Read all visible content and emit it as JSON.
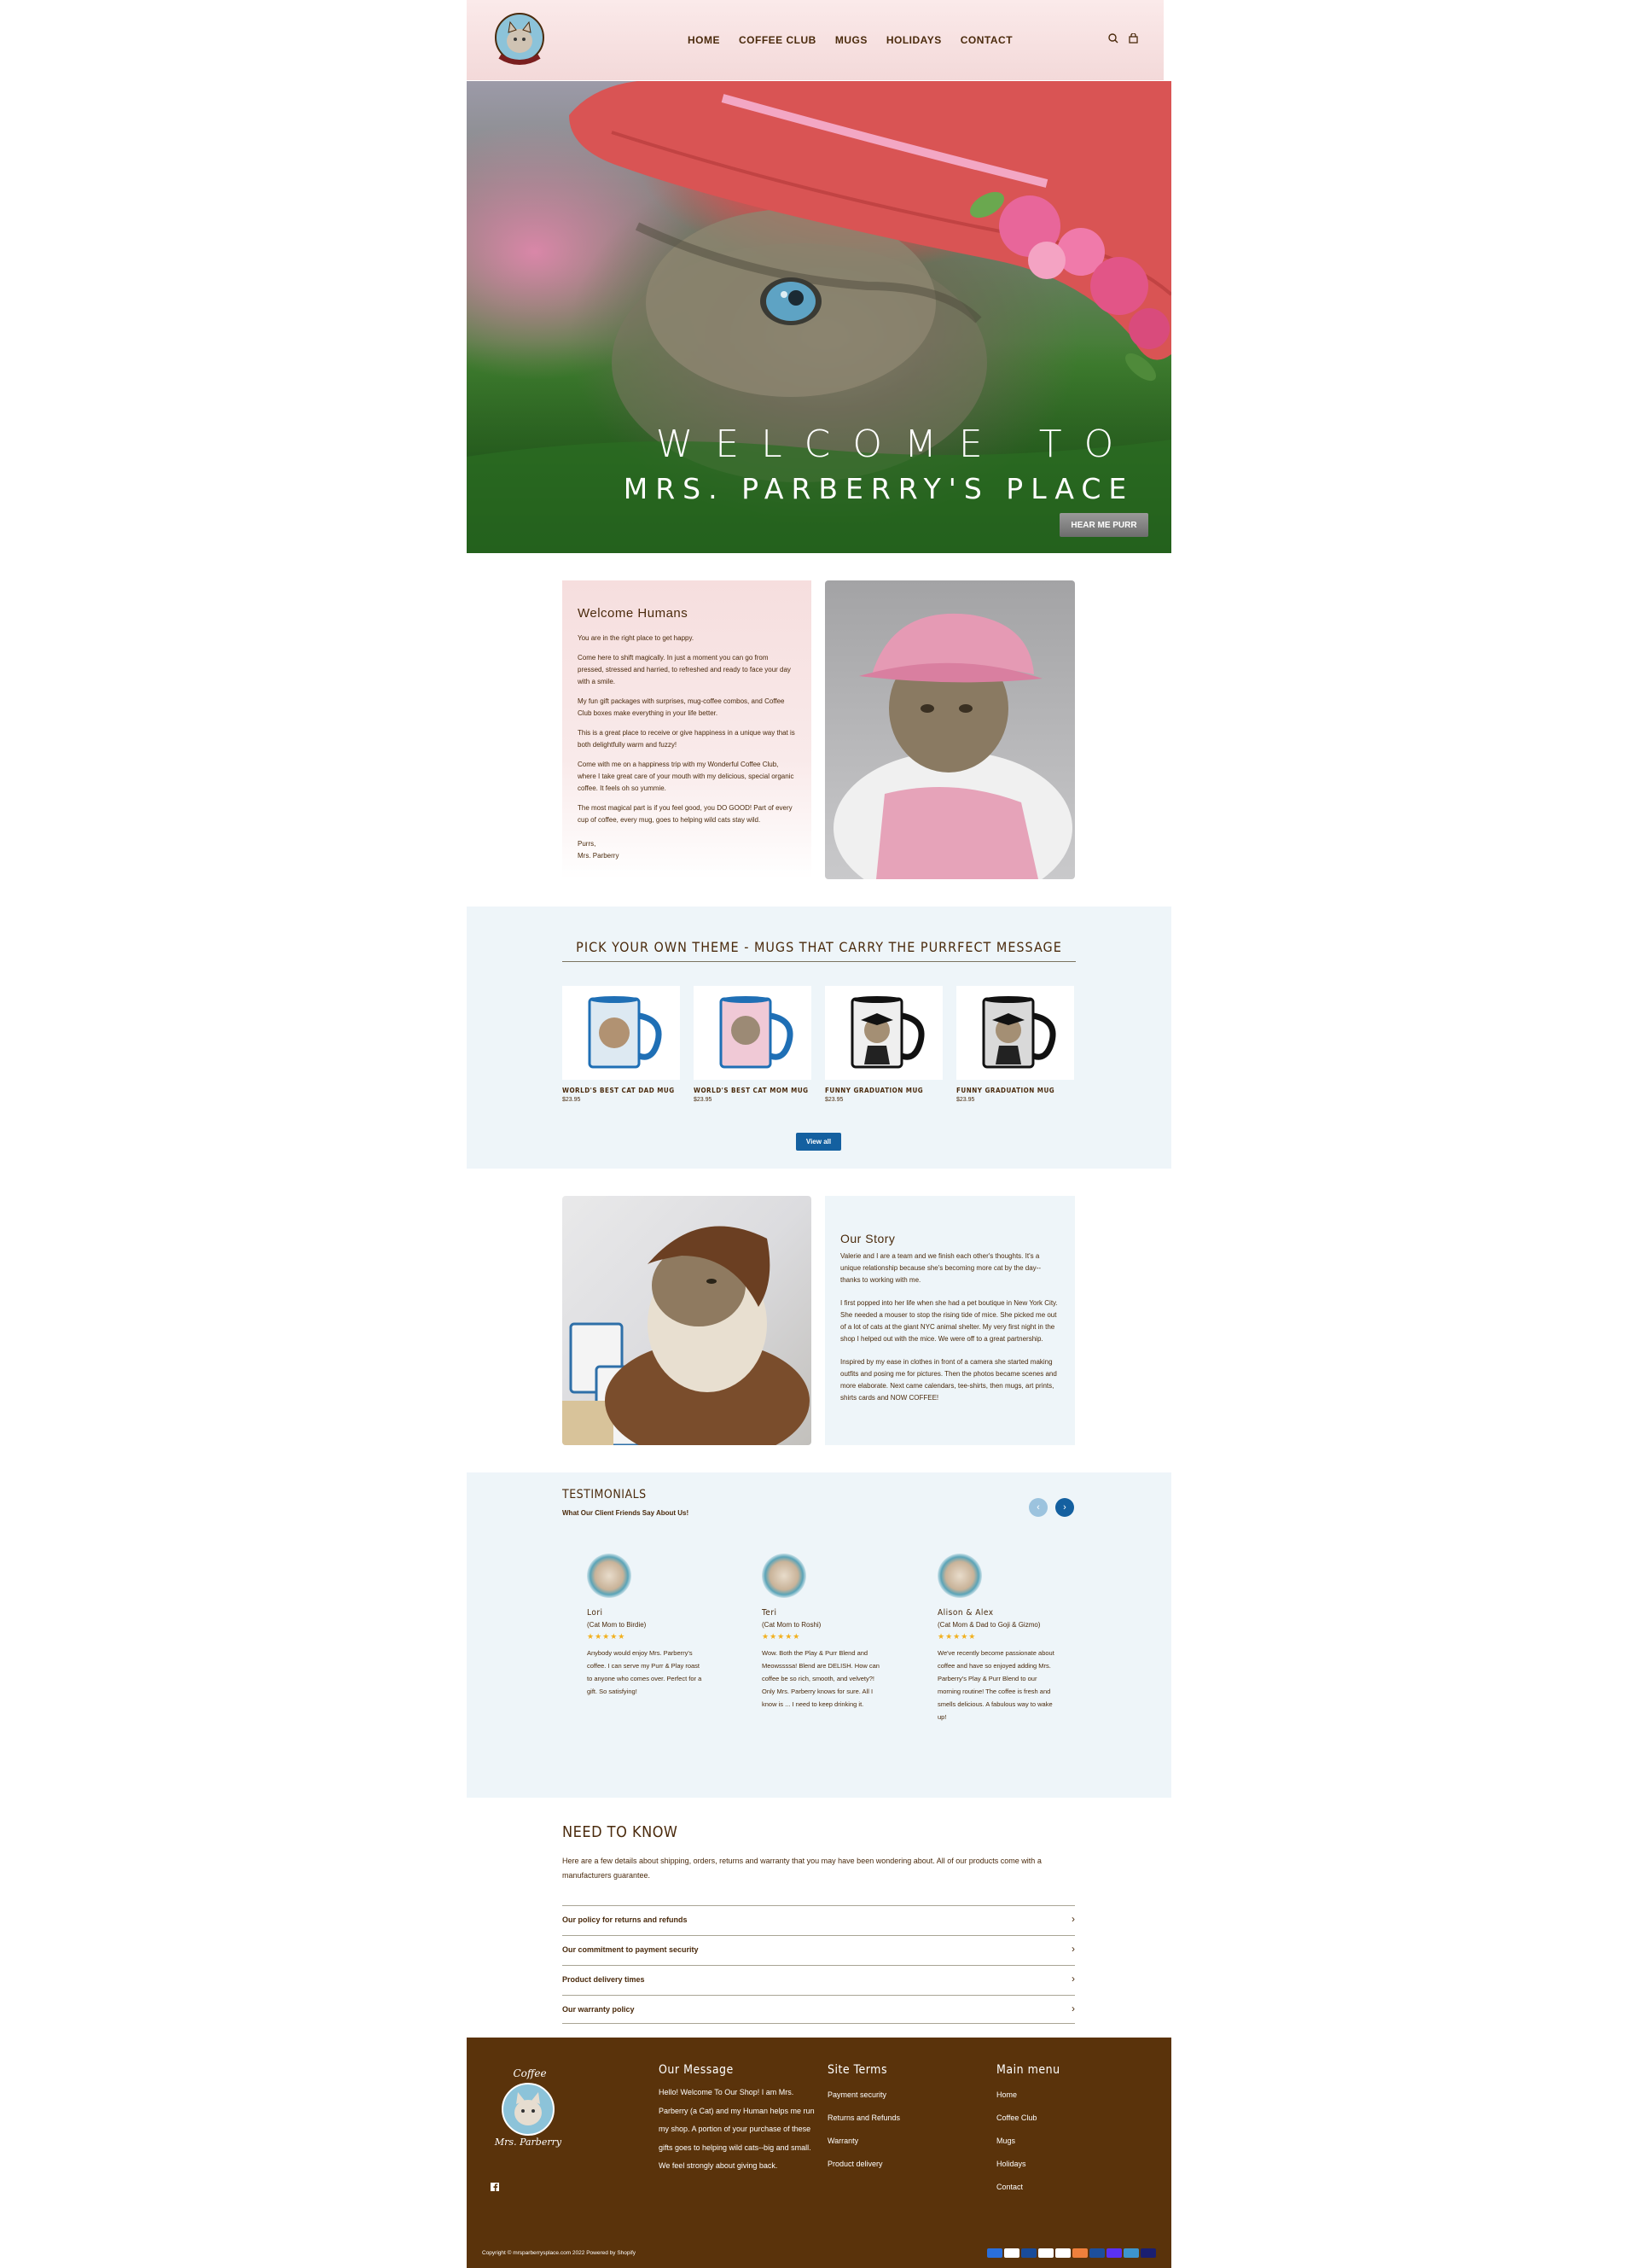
{
  "header": {
    "logo_alt": "Mrs. Parberry",
    "nav": [
      "HOME",
      "COFFEE CLUB",
      "MUGS",
      "HOLIDAYS",
      "CONTACT"
    ]
  },
  "hero": {
    "title_line1": "WELCOME TO",
    "title_line2": "MRS. PARBERRY'S PLACE",
    "button_label": "HEAR ME PURR"
  },
  "welcome": {
    "heading": "Welcome Humans",
    "paragraphs": [
      "You are in the right place to get happy.",
      "Come here to shift magically. In just a moment you can go from pressed, stressed and harried, to refreshed and ready to face your day with a smile.",
      "My fun gift packages with surprises, mug-coffee combos, and Coffee Club boxes make everything in your life better.",
      "This is a great place to receive or give happiness in a unique way that is both delightfully warm and fuzzy!",
      "Come with me on a happiness trip with my Wonderful Coffee Club, where I take great care of your mouth with my delicious, special organic coffee. It feels oh so yummie.",
      "The most magical part is if you feel good, you DO GOOD! Part of every cup of coffee, every mug, goes to helping wild cats stay wild.",
      "Purrs,",
      "Mrs. Parberry"
    ]
  },
  "mugs": {
    "title": "PICK YOUR OWN THEME  - MUGS THAT CARRY THE PURRFECT MESSAGE",
    "items": [
      {
        "name": "WORLD'S BEST CAT DAD MUG",
        "price": "$23.95"
      },
      {
        "name": "WORLD'S BEST CAT MOM MUG",
        "price": "$23.95"
      },
      {
        "name": "FUNNY GRADUATION MUG",
        "price": "$23.95"
      },
      {
        "name": "FUNNY GRADUATION MUG",
        "price": "$23.95"
      }
    ],
    "view_all": "View all"
  },
  "story": {
    "heading": "Our Story",
    "paragraphs": [
      "Valerie and I are a team and we finish each other's thoughts. It's a unique relationship because she's becoming more cat by the day--thanks to working with me.",
      "I first popped into her life when she had a pet boutique in New York City. She needed a mouser to stop the rising tide of mice. She picked me out of a lot of cats at the giant NYC animal shelter. My very first night in the shop I helped out with the mice. We were off to a great partnership.",
      "Inspired by my ease in clothes in front of a camera she started making outfits and posing me for pictures. Then the photos became scenes and more elaborate. Next came calendars, tee-shirts, then mugs, art prints, shirts cards and NOW COFFEE!"
    ]
  },
  "testimonials": {
    "title": "TESTIMONIALS",
    "subtitle": "What Our Client Friends Say About Us!",
    "prev": "‹",
    "next": "›",
    "items": [
      {
        "name": "Lori",
        "relation": "(Cat Mom to Birdie)",
        "stars": "★★★★★",
        "text": "Anybody would enjoy Mrs. Parberry's coffee. I can serve my Purr & Play roast to anyone who comes over. Perfect for a gift. So satisfying!"
      },
      {
        "name": "Teri",
        "relation": "(Cat Mom to Roshi)",
        "stars": "★★★★★",
        "text": "Wow. Both the Play & Purr Blend and Meowssssa! Blend are DELISH. How can coffee be so rich, smooth, and velvety?! Only Mrs. Parberry knows for sure. All I know is ... I need to keep drinking it."
      },
      {
        "name": "Alison & Alex",
        "relation": "(Cat Mom & Dad to Goji & Gizmo)",
        "stars": "★★★★★",
        "text": "We've recently become passionate about coffee and have so enjoyed adding Mrs. Parberry's Play & Purr Blend to our morning routine! The coffee is fresh and smells delicious. A fabulous way to wake up!"
      }
    ]
  },
  "need_to_know": {
    "title": "NEED TO KNOW",
    "intro": "Here are a few details about shipping, orders, returns and warranty that you may have been wondering about. All of our products come with a manufacturers guarantee.",
    "items": [
      "Our policy for returns and refunds",
      "Our commitment to payment security",
      "Product delivery times",
      "Our warranty policy"
    ]
  },
  "footer": {
    "logo_text_top": "Coffee",
    "logo_text_bottom": "Mrs. Parberry",
    "message_title": "Our Message",
    "message_text": "Hello! Welcome To Our Shop! I am Mrs. Parberry (a Cat) and my Human helps me run my shop. A portion of your purchase of these gifts goes to helping wild cats--big and small. We feel strongly about giving back.",
    "terms_title": "Site Terms",
    "terms_links": [
      "Payment security",
      "Returns and Refunds",
      "Warranty",
      "Product delivery"
    ],
    "menu_title": "Main menu",
    "menu_links": [
      "Home",
      "Coffee Club",
      "Mugs",
      "Holidays",
      "Contact"
    ],
    "copyright": "Copyright © mrsparberrysplace.com 2022     Powered by Shopify",
    "payment_icons": [
      "american-express-icon",
      "apple-pay-icon",
      "diners-club-icon",
      "discover-icon",
      "google-pay-icon",
      "mastercard-icon",
      "paypal-icon",
      "shop-pay-icon",
      "venmo-icon",
      "visa-icon"
    ]
  },
  "colors": {
    "brand_brown": "#5a330b",
    "accent_blue": "#1460a0",
    "band_blue": "#eef5f9",
    "header_pink": "#f3d9d9"
  }
}
